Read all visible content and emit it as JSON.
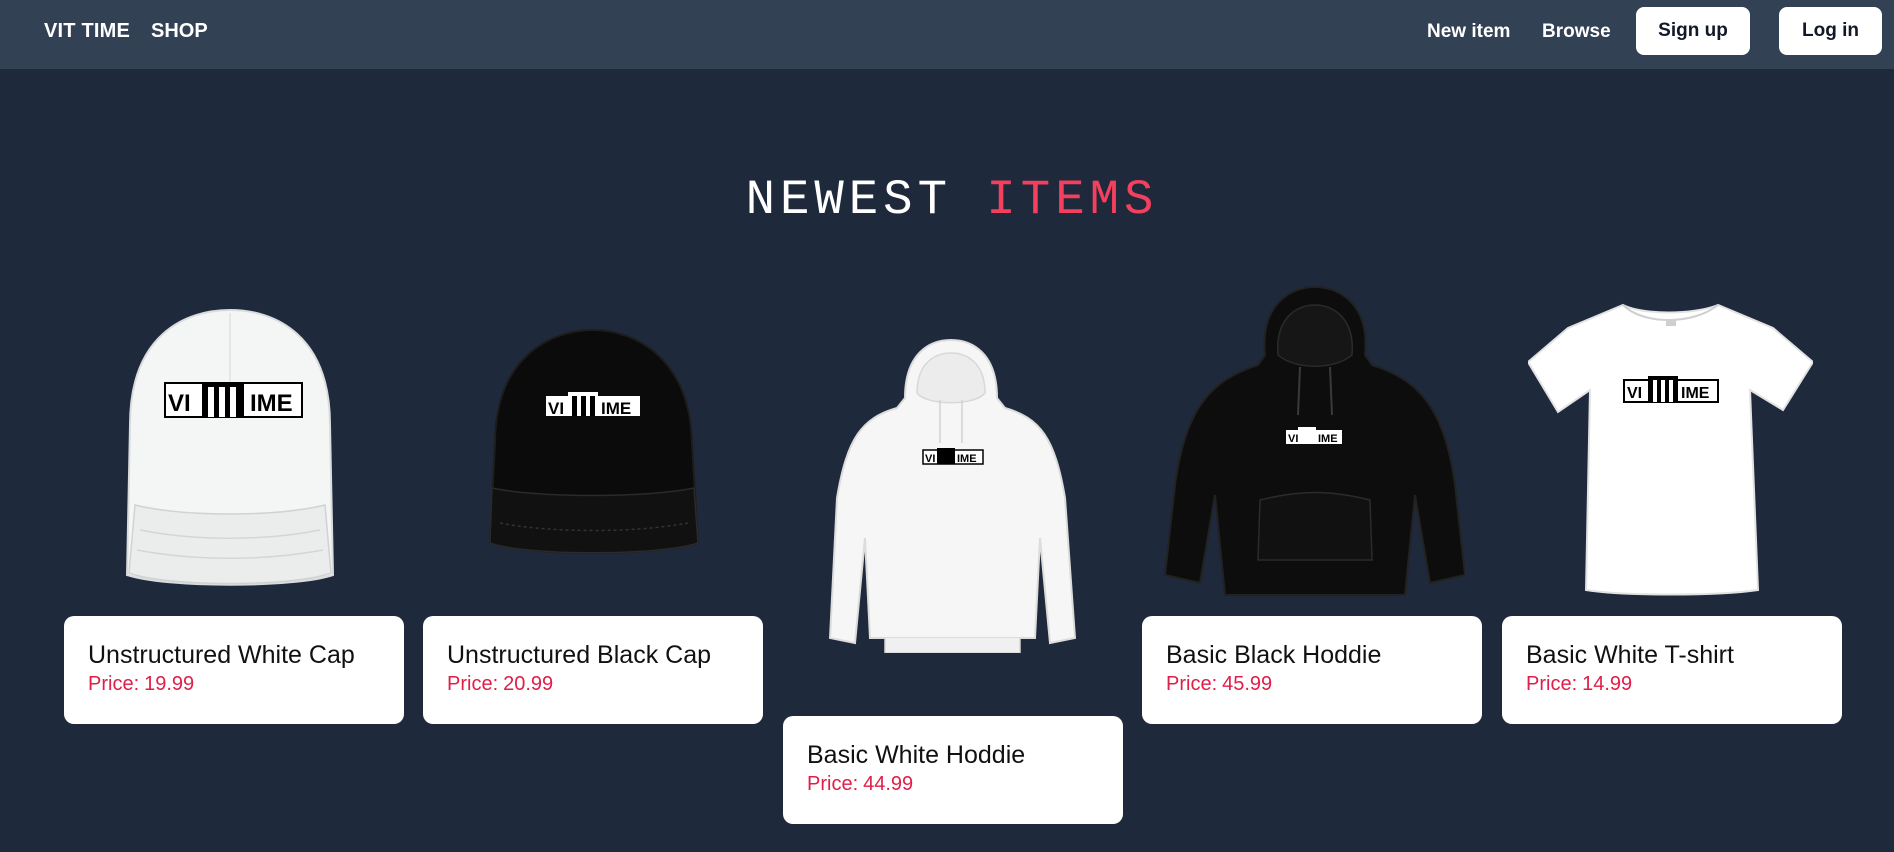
{
  "nav": {
    "brand": "VIT TIME",
    "shop": "SHOP",
    "new_item": "New item",
    "browse": "Browse",
    "sign_up": "Sign up",
    "log_in": "Log in"
  },
  "heading": {
    "part1": "NEWEST",
    "part2": "ITEMS"
  },
  "price_label": "Price:",
  "logo_text": "VITTIME",
  "products": [
    {
      "name": "Unstructured White Cap",
      "price": "19.99",
      "icon": "white-cap"
    },
    {
      "name": "Unstructured Black Cap",
      "price": "20.99",
      "icon": "black-cap"
    },
    {
      "name": "Basic White Hoddie",
      "price": "44.99",
      "icon": "white-hoodie"
    },
    {
      "name": "Basic Black Hoddie",
      "price": "45.99",
      "icon": "black-hoodie"
    },
    {
      "name": "Basic White T-shirt",
      "price": "14.99",
      "icon": "white-tshirt"
    }
  ],
  "colors": {
    "background": "#1e293b",
    "navbar": "#334155",
    "accent": "#f43f5e",
    "price": "#e11d48"
  }
}
